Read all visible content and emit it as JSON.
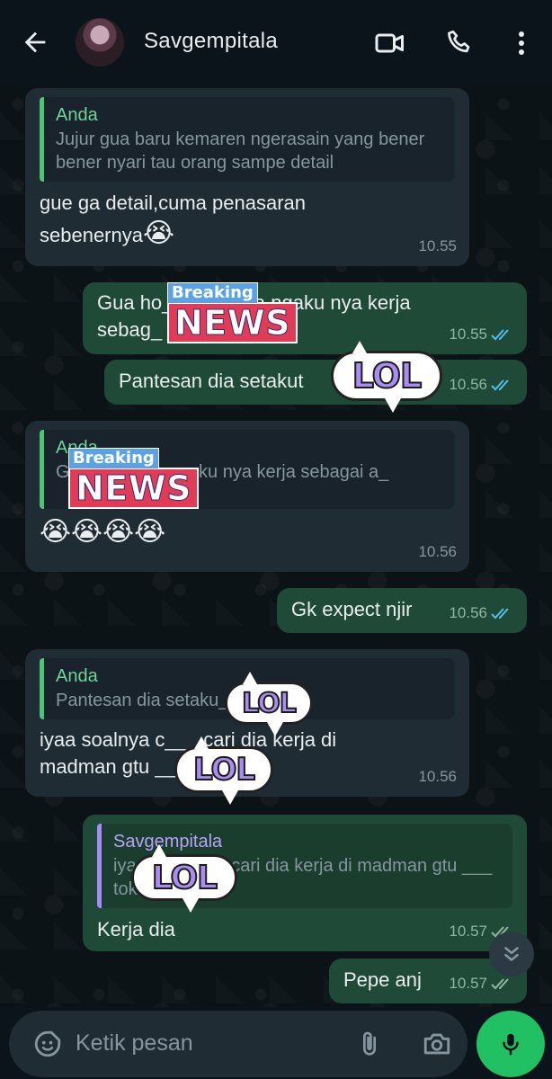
{
  "header": {
    "contact_name": "Savgempitala"
  },
  "messages": [
    {
      "direction": "in",
      "quote_author": "Anda",
      "quote_text": "Jujur gua baru kemaren ngerasain yang bener bener nyari tau orang sampe detail",
      "text": "gue ga detail,cuma penasaran sebenernya",
      "emoji": "😭",
      "time": "10.55"
    },
    {
      "direction": "out",
      "text": "Gua ho___ ___ dia ngaku nya kerja sebag_ ___ ___n",
      "time": "10.55"
    },
    {
      "direction": "out",
      "text": "Pantesan dia setakut",
      "time": "10.56"
    },
    {
      "direction": "in",
      "quote_author": "Anda",
      "quote_text": "G___ ___ dia ngaku nya kerja sebagai a_",
      "emoji": "😭😭😭😭",
      "time": "10.56"
    },
    {
      "direction": "out",
      "text": "Gk expect njir",
      "time": "10.56"
    },
    {
      "direction": "in",
      "quote_author": "Anda",
      "quote_text": "Pantesan dia setaku_ ___ x",
      "text": "iyaa soalnya c___ cari dia kerja di madman gtu ___ toko baju",
      "time": "10.56"
    },
    {
      "direction": "out",
      "quote_author": "Savgempitala",
      "quote_text": "iya___ ___ma cari dia kerja di madman gtu ___ toko baju",
      "text": "Kerja dia",
      "time": "10.57"
    },
    {
      "direction": "out",
      "text": "Pepe anj",
      "time": "10.57"
    }
  ],
  "stickers": {
    "breaking_small": "Breaking",
    "breaking_big": "NEWS",
    "lol": "LOL"
  },
  "input": {
    "placeholder": "Ketik pesan"
  },
  "colors": {
    "background": "#0b141a",
    "incoming_bubble": "#1f2c34",
    "outgoing_bubble": "#1f4a37",
    "mic_button": "#21c063",
    "read_ticks": "#53bdeb"
  }
}
